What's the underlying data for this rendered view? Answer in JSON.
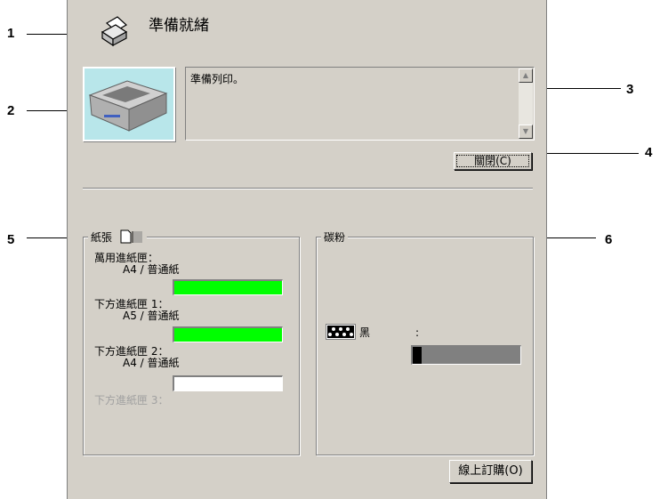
{
  "callouts": [
    "1",
    "2",
    "3",
    "4",
    "5",
    "6"
  ],
  "status": {
    "title": "準備就緒",
    "message": "準備列印。"
  },
  "buttons": {
    "close": "關閉(C)",
    "online_order": "線上訂購(O)"
  },
  "paper": {
    "title": "紙張",
    "trays": [
      {
        "name": "萬用進紙匣：",
        "size": "A4 / 普通紙",
        "level": 1.0,
        "fill_color": "#00ff00",
        "enabled": true
      },
      {
        "name": "下方進紙匣 1：",
        "size": "A5 / 普通紙",
        "level": 1.0,
        "fill_color": "#00ff00",
        "enabled": true
      },
      {
        "name": "下方進紙匣 2：",
        "size": "A4 / 普通紙",
        "level": 0.0,
        "fill_color": "#ffffff",
        "enabled": true
      },
      {
        "name": "下方進紙匣 3：",
        "enabled": false
      }
    ]
  },
  "toner": {
    "title": "碳粉",
    "color_name": "黑",
    "colon": ":",
    "level": 0.08,
    "fill_color": "#000000",
    "track_color": "#808080"
  },
  "icons": [
    "printer-status-icon",
    "printer-image-icon",
    "paper-icon",
    "toner-icon"
  ]
}
